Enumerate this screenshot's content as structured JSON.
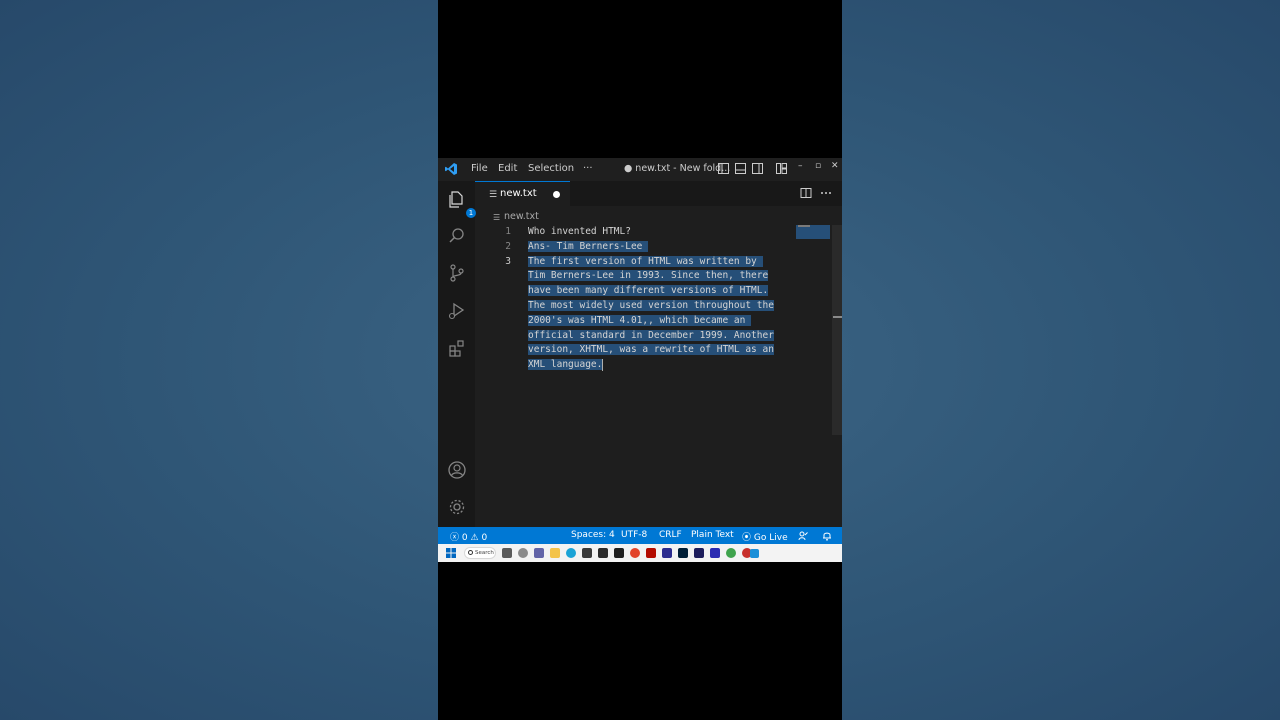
{
  "menu": {
    "file": "File",
    "edit": "Edit",
    "selection": "Selection",
    "more": "···"
  },
  "window": {
    "title": "● new.txt - New fold...",
    "minimize": "–",
    "maximize": "▫",
    "close": "✕"
  },
  "explorer_badge": "1",
  "tab": {
    "label": "new.txt"
  },
  "breadcrumb": {
    "file": "new.txt"
  },
  "editor": {
    "line_numbers": [
      "1",
      "2",
      "3"
    ],
    "lines": [
      "Who invented HTML?",
      "Ans- Tim Berners-Lee ",
      "The first version of HTML was written by ",
      "Tim Berners-Lee in 1993. Since then, there",
      "have been many different versions of HTML.",
      "The most widely used version throughout the",
      "2000's was HTML 4.01,, which became an ",
      "official standard in December 1999. Another",
      "version, XHTML, was a rewrite of HTML as an",
      "XML language."
    ]
  },
  "status": {
    "errors": "0",
    "warnings": "0",
    "spaces": "Spaces: 4",
    "encoding": "UTF-8",
    "eol": "CRLF",
    "language": "Plain Text",
    "golive": "Go Live"
  },
  "taskbar": {
    "search": "Search"
  },
  "colors": {
    "accent": "#0078d4",
    "selection": "#264f78",
    "editor_bg": "#1e1e1e"
  }
}
